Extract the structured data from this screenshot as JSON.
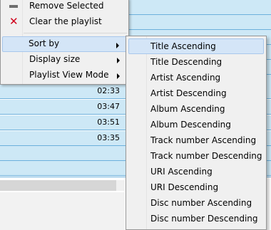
{
  "playlist": {
    "durations": [
      "02:33",
      "03:47",
      "03:51",
      "03:35"
    ]
  },
  "context_menu": {
    "items": [
      {
        "label": "Remove Selected",
        "icon": "remove-icon"
      },
      {
        "label": "Clear the playlist",
        "icon": "clear-icon"
      },
      {
        "label": "Sort by",
        "submenu": true
      },
      {
        "label": "Display size",
        "submenu": true
      },
      {
        "label": "Playlist View Mode",
        "submenu": true
      }
    ]
  },
  "sort_submenu": {
    "items": [
      "Title Ascending",
      "Title Descending",
      "Artist Ascending",
      "Artist Descending",
      "Album Ascending",
      "Album Descending",
      "Track number Ascending",
      "Track number Descending",
      "URI Ascending",
      "URI Descending",
      "Disc number Ascending",
      "Disc number Descending"
    ]
  },
  "colors": {
    "row_bg": "#cde8f6",
    "row_border": "#6cb0dc",
    "menu_bg": "#f0f0f0",
    "highlight_bg": "#d4e5f7",
    "clear_icon": "#d0021b"
  }
}
